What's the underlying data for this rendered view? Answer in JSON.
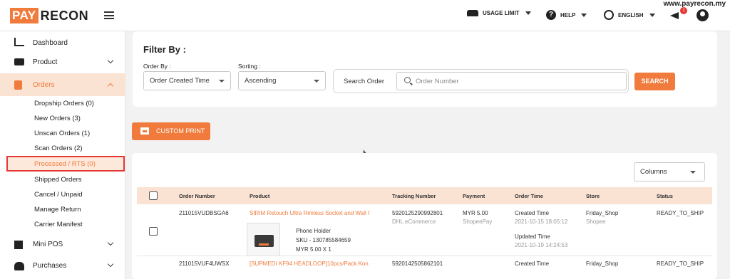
{
  "header": {
    "logo_part1": "PAY",
    "logo_part2": "RECON",
    "website": "www.payrecon.my",
    "usage_limit": "USAGE LIMIT",
    "help": "HELP",
    "language": "ENGLISH",
    "notification_count": "1"
  },
  "sidebar": {
    "dashboard": "Dashboard",
    "product": "Product",
    "orders": "Orders",
    "orders_sub": [
      "Dropship Orders (0)",
      "New Orders (3)",
      "Unscan Orders (1)",
      "Scan Orders (2)",
      "Processed / RTS (0)",
      "Shipped Orders",
      "Cancel / Unpaid",
      "Manage Return",
      "Carrier Manifest"
    ],
    "mini_pos": "Mini POS",
    "purchases": "Purchases"
  },
  "filter": {
    "title": "Filter By :",
    "order_by_label": "Order By :",
    "order_by_value": "Order Created Time",
    "sorting_label": "Sorting :",
    "sorting_value": "Ascending",
    "search_label": "Search Order",
    "search_placeholder": "Order Number",
    "search_button": "SEARCH"
  },
  "print_button": "CUSTOM PRINT",
  "table": {
    "columns_select": "Columns",
    "headers": [
      "Order Number",
      "Product",
      "Tracking Number",
      "Payment",
      "Order Time",
      "Store",
      "Status"
    ],
    "rows": [
      {
        "order_number": "211015VUDBSGA6",
        "product_title": "SIRIM Retouch Ultra Rimless Socket and Wall I",
        "product_name": "Phone Holder",
        "sku": "SKU - 130785584659",
        "price_qty": "MYR 5.00 X 1",
        "tracking": "5920125290992801",
        "carrier": "DHL eCommerce",
        "payment_amount": "MYR 5.00",
        "payment_method": "ShopeePay",
        "created_label": "Created Time",
        "created_time": "2021-10-15 18:05:12",
        "updated_label": "Updated Time",
        "updated_time": "2021-10-19 14:24:53",
        "store": "Friday_Shop",
        "platform": "Shopee",
        "status": "READY_TO_SHIP"
      },
      {
        "order_number": "211015VUF4UWSX",
        "product_title": "[SUPMEDI KF94 HEADLOOP]10pcs/Pack Kon",
        "tracking": "5920142505862101",
        "payment_amount": "",
        "created_label": "Created Time",
        "store": "Friday_Shop",
        "status": "READY_TO_SHIP"
      }
    ]
  }
}
